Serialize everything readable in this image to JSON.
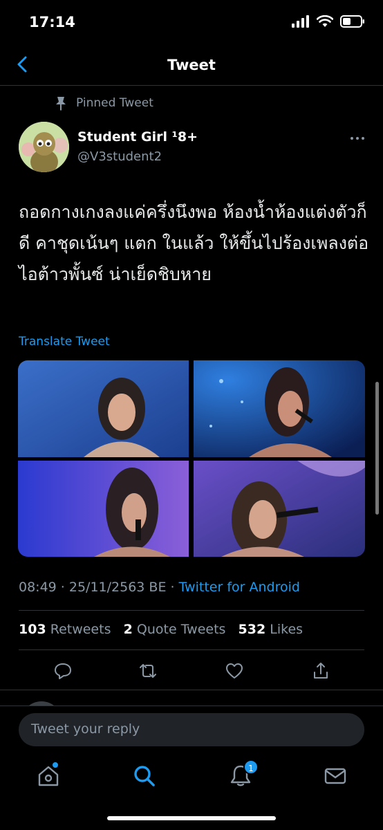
{
  "status": {
    "time": "17:14"
  },
  "header": {
    "title": "Tweet"
  },
  "pinned_label": "Pinned Tweet",
  "user": {
    "name": "Student Girl ¹8+",
    "handle": "@V3student2"
  },
  "tweet": {
    "text": "ถอดกางเกงลงแค่ครึ่งนึงพอ ห้องน้ำห้องแต่งตัวก็ดี คาชุดเน้นๆ แตก ในแล้ว ให้ขึ้นไปร้องเพลงต่อ ไอต้าวพั้นซ์ น่าเย็ดชิบหาย",
    "translate": "Translate Tweet",
    "timestamp": "08:49 · 25/11/2563 BE · ",
    "source": "Twitter for Android"
  },
  "stats": {
    "retweets_count": "103",
    "retweets_label": "Retweets",
    "quotes_count": "2",
    "quotes_label": "Quote Tweets",
    "likes_count": "532",
    "likes_label": "Likes"
  },
  "reply": {
    "placeholder": "Tweet your reply"
  },
  "tabbar": {
    "notifications_badge": "1"
  },
  "icons": {
    "back": "chevron-left-icon",
    "pin": "pin-icon",
    "more": "more-horizontal-icon",
    "reply": "reply-icon",
    "retweet": "retweet-icon",
    "like": "heart-icon",
    "share": "share-icon",
    "home": "home-icon",
    "search": "search-icon",
    "notifications": "bell-icon",
    "messages": "mail-icon"
  },
  "colors": {
    "accent": "#1d9bf0",
    "background": "#000000",
    "muted": "#8b98a5",
    "divider": "#2f3336"
  }
}
